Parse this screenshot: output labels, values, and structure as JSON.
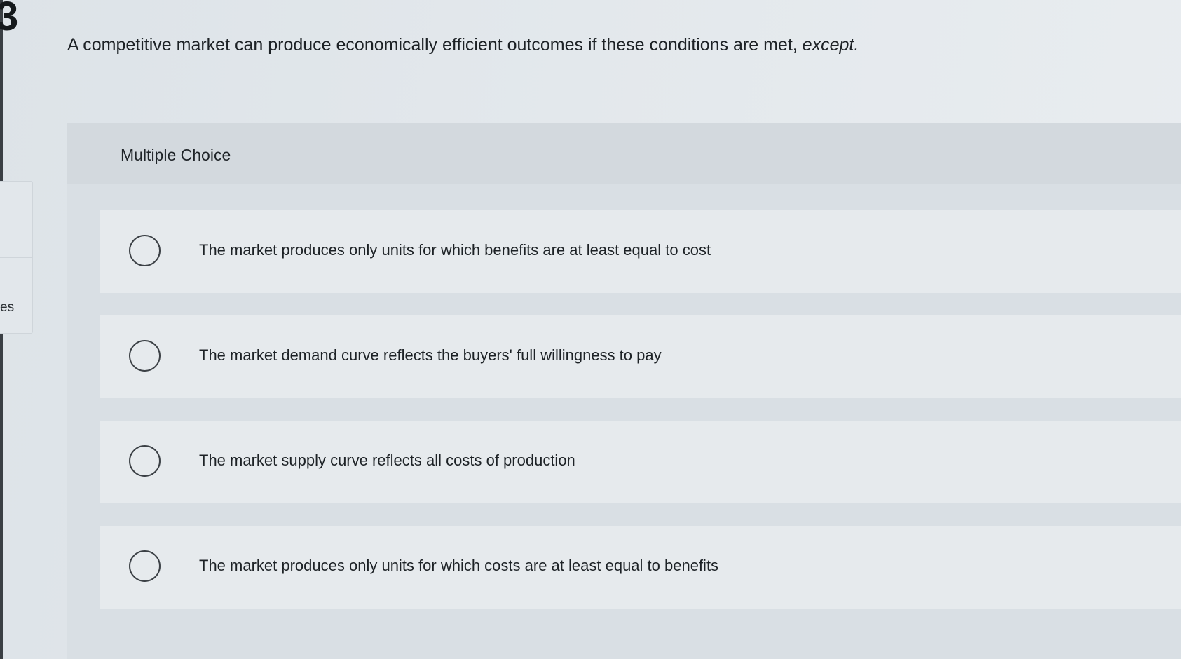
{
  "question": {
    "number": "3",
    "text": "A competitive market can produce economically efficient outcomes if these conditions are met, ",
    "emphasis": "except."
  },
  "sidebar": {
    "partial_label": "es"
  },
  "choices": {
    "heading": "Multiple Choice",
    "options": [
      {
        "label": "The market produces only units for which benefits are at least equal to cost",
        "selected": false
      },
      {
        "label": "The market demand curve reflects the buyers' full willingness to pay",
        "selected": false
      },
      {
        "label": "The market supply curve reflects all costs of production",
        "selected": false
      },
      {
        "label": "The market produces only units for which costs are at least equal to benefits",
        "selected": false
      }
    ]
  }
}
